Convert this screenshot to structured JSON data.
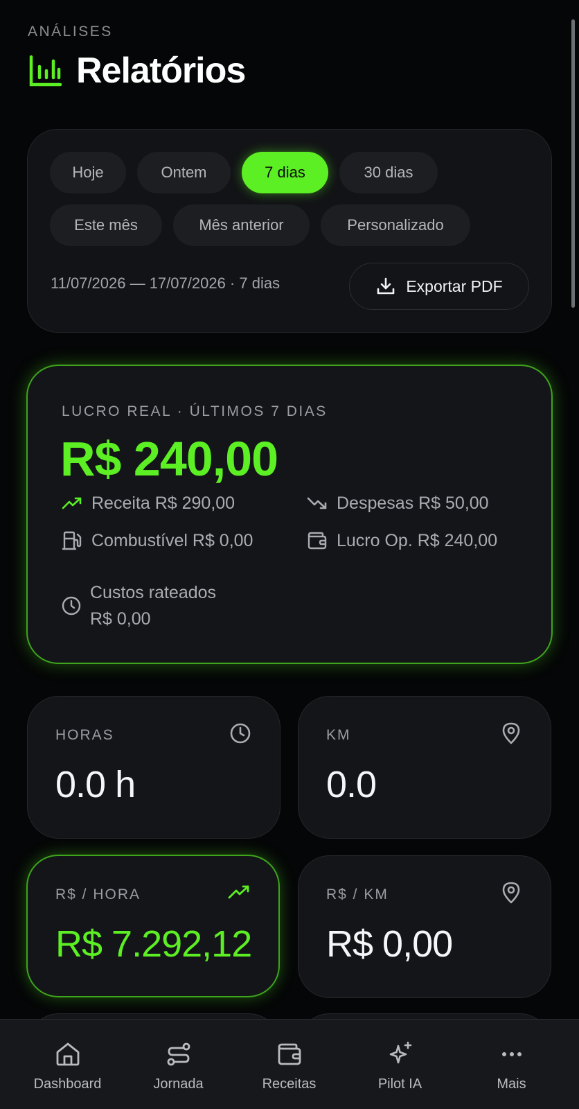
{
  "header": {
    "eyebrow": "ANÁLISES",
    "title": "Relatórios",
    "icon": "bar-chart-icon"
  },
  "filters": {
    "chips": [
      "Hoje",
      "Ontem",
      "7 dias",
      "30 dias",
      "Este mês",
      "Mês anterior",
      "Personalizado"
    ],
    "active": "7 dias",
    "range_text": "11/07/2026 — 17/07/2026 · 7 dias",
    "export_label": "Exportar PDF"
  },
  "profit": {
    "label": "LUCRO REAL · ÚLTIMOS 7 DIAS",
    "value": "R$ 240,00",
    "revenue": "Receita R$ 290,00",
    "expenses": "Despesas R$ 50,00",
    "fuel": "Combustível R$ 0,00",
    "op_profit": "Lucro Op. R$ 240,00",
    "shared_costs_label": "Custos rateados",
    "shared_costs_value": "R$ 0,00"
  },
  "metrics": {
    "hours": {
      "label": "HORAS",
      "value": "0.0 h",
      "icon": "clock-icon"
    },
    "km": {
      "label": "KM",
      "value": "0.0",
      "icon": "map-pin-icon"
    },
    "per_hour": {
      "label": "R$ / HORA",
      "value": "R$ 7.292,12",
      "icon": "trending-up-icon"
    },
    "per_km": {
      "label": "R$ / KM",
      "value": "R$ 0,00",
      "icon": "map-pin-icon"
    }
  },
  "nav": {
    "dashboard": "Dashboard",
    "jornada": "Jornada",
    "receitas": "Receitas",
    "pilot": "Pilot IA",
    "mais": "Mais"
  },
  "colors": {
    "accent": "#5cf024",
    "background": "#050607",
    "card": "#141518"
  }
}
